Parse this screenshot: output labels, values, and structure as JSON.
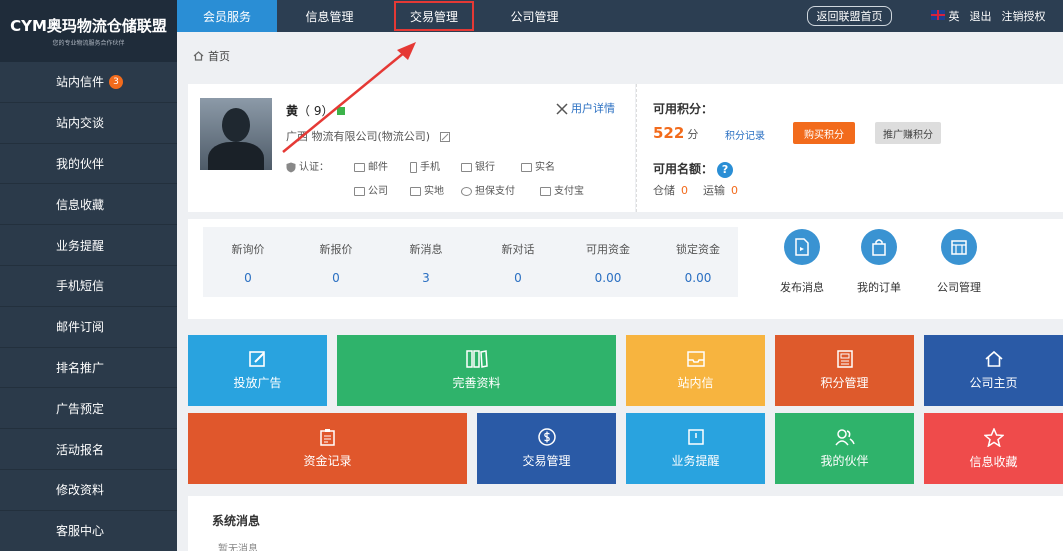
{
  "logo": {
    "text": "CYM奥玛物流仓储联盟",
    "sub": "您的专业物流服务合作伙伴"
  },
  "sidebar": {
    "items": [
      {
        "label": "站内信件",
        "badge": "3"
      },
      {
        "label": "站内交谈"
      },
      {
        "label": "我的伙伴"
      },
      {
        "label": "信息收藏"
      },
      {
        "label": "业务提醒"
      },
      {
        "label": "手机短信"
      },
      {
        "label": "邮件订阅"
      },
      {
        "label": "排名推广"
      },
      {
        "label": "广告预定"
      },
      {
        "label": "活动报名"
      },
      {
        "label": "修改资料"
      },
      {
        "label": "客服中心"
      }
    ]
  },
  "topbar": {
    "nav": [
      "会员服务",
      "信息管理",
      "交易管理",
      "公司管理"
    ],
    "back_label": "返回联盟首页",
    "lang": "英",
    "logout": "退出",
    "deauth": "注销授权"
  },
  "breadcrumb": {
    "home": "首页"
  },
  "profile": {
    "name": "黄",
    "name_suffix": "（        9）",
    "company": "广西        物流有限公司(物流公司)",
    "detail_link": "用户详情",
    "cert_label": "认证：",
    "certs_row1": [
      "邮件",
      "手机",
      "银行",
      "实名"
    ],
    "certs_row2": [
      "公司",
      "实地",
      "担保支付",
      "支付宝"
    ]
  },
  "points": {
    "available_label": "可用积分：",
    "value": "522",
    "unit": "分",
    "record_link": "积分记录",
    "buy_label": "购买积分",
    "promo_label": "推广赚积分",
    "quota_label": "可用名额：",
    "storage_label": "仓储",
    "storage_value": "0",
    "transport_label": "运输",
    "transport_value": "0"
  },
  "stats": [
    {
      "label": "新询价",
      "value": "0"
    },
    {
      "label": "新报价",
      "value": "0"
    },
    {
      "label": "新消息",
      "value": "3"
    },
    {
      "label": "新对话",
      "value": "0"
    },
    {
      "label": "可用资金",
      "value": "0.00"
    },
    {
      "label": "锁定资金",
      "value": "0.00"
    }
  ],
  "quick_actions": [
    "发布消息",
    "我的订单",
    "公司管理"
  ],
  "tiles": [
    {
      "label": "投放广告",
      "color": "#29a3df"
    },
    {
      "label": "完善资料",
      "color": "#2fb36b"
    },
    {
      "label": "站内信",
      "color": "#f7b43f"
    },
    {
      "label": "积分管理",
      "color": "#de5a2c"
    },
    {
      "label": "公司主页",
      "color": "#2a5aa6"
    },
    {
      "label": "资金记录",
      "color": "#e0572c"
    },
    {
      "label": "交易管理",
      "color": "#2a5aa6"
    },
    {
      "label": "业务提醒",
      "color": "#29a3df"
    },
    {
      "label": "我的伙伴",
      "color": "#2fb36b"
    },
    {
      "label": "信息收藏",
      "color": "#ef4b4b"
    }
  ],
  "system": {
    "title": "系统消息",
    "empty": "暂无消息"
  },
  "colors": {
    "sidebar": "#2b3a4a",
    "topbar": "#2c3e52",
    "accent": "#2a8ed5",
    "orange": "#f26b1c",
    "annotation": "#e53935"
  }
}
